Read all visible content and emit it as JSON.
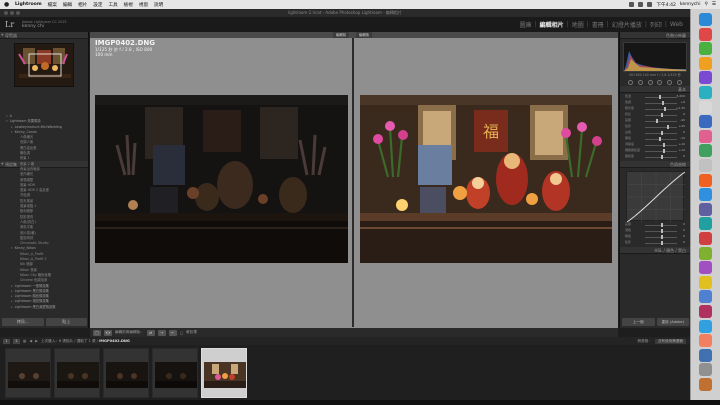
{
  "menubar": {
    "items": [
      "Lightroom",
      "檔案",
      "編輯",
      "相片",
      "設定",
      "工具",
      "檢視",
      "視窗",
      "說明"
    ],
    "clock": "下午4:42",
    "user": "kennychi"
  },
  "window_title": "lightroom-2.lrcat - Adobe Photoshop Lightroom - 編輯相片",
  "identity": {
    "line1": "Adobe Lightroom CC 2015",
    "line2": "kenny chi"
  },
  "modules": [
    {
      "label": "圖庫",
      "active": false
    },
    {
      "label": "編輯相片",
      "active": true
    },
    {
      "label": "地圖",
      "active": false
    },
    {
      "label": "書冊",
      "active": false
    },
    {
      "label": "幻燈片播放",
      "active": false
    },
    {
      "label": "列印",
      "active": false
    },
    {
      "label": "Web",
      "active": false
    }
  ],
  "left_panel": {
    "navigator_title": "導覽器",
    "presets_title": "預設集",
    "presets": [
      {
        "label": "A",
        "level": 0,
        "open": true
      },
      {
        "label": "Lightroom 效果預設",
        "level": 0,
        "open": true
      },
      {
        "label": "Lowkeyinstruct-MiniWedding",
        "level": 1
      },
      {
        "label": "Kenny_Canon",
        "level": 1,
        "open": true
      },
      {
        "label": "人像補光",
        "level": 2
      },
      {
        "label": "低調人像",
        "level": 2
      },
      {
        "label": "黑白高反差",
        "level": 2
      },
      {
        "label": "暖色調",
        "level": 2
      },
      {
        "label": "夜景 1",
        "level": 2
      },
      {
        "label": "夜景 2 暖",
        "level": 2
      },
      {
        "label": "夜景加亮暗部",
        "level": 2
      },
      {
        "label": "室內補光",
        "level": 2
      },
      {
        "label": "食物調整",
        "level": 2
      },
      {
        "label": "風景 HDR",
        "level": 2
      },
      {
        "label": "風景 HDR 2 高反差",
        "level": 2
      },
      {
        "label": "冷色調",
        "level": 2
      },
      {
        "label": "陰天風景",
        "level": 2
      },
      {
        "label": "風景增豔 1",
        "level": 2
      },
      {
        "label": "銳利細節",
        "level": 2
      },
      {
        "label": "陰影提亮",
        "level": 2
      },
      {
        "label": "人像(亮白)",
        "level": 2
      },
      {
        "label": "膚色平衡",
        "level": 2
      },
      {
        "label": "底片感(暖)",
        "level": 2
      },
      {
        "label": "藍色時刻",
        "level": 2
      },
      {
        "label": "Chromatic Studio",
        "level": 2
      },
      {
        "label": "Kenny_Nikon",
        "level": 1,
        "open": true
      },
      {
        "label": "Nikon_A_Profit",
        "level": 2
      },
      {
        "label": "Nikon_A_Profit 2",
        "level": 2
      },
      {
        "label": "Nik 暗部",
        "level": 2
      },
      {
        "label": "Nikon 夜景",
        "level": 2
      },
      {
        "label": "Nikon City 暖色後期",
        "level": 2
      },
      {
        "label": "Chrome 色調加深",
        "level": 2
      },
      {
        "label": "Lightroom 一般預設集",
        "level": 1
      },
      {
        "label": "Lightroom 黑白預設集",
        "level": 1
      },
      {
        "label": "Lightroom 顏色預設集",
        "level": 1
      },
      {
        "label": "Lightroom 視訊預設集",
        "level": 1
      },
      {
        "label": "Lightroom 黑白濾鏡預設集",
        "level": 1
      },
      {
        "label": "Lightroom 黑白調色預設集",
        "level": 1
      },
      {
        "label": "Lightroom 曲線預設集",
        "level": 1
      }
    ],
    "copy_button": "拷貝...",
    "paste_button": "貼上"
  },
  "center": {
    "before_label": "編輯前",
    "after_label": "編輯後",
    "filename": "IMGP0402.DNG",
    "exposure": "1/125 秒 於 f / 2.8 , ISO 800",
    "focal": "100 mm",
    "toolbar_label": "編輯前與編輯後：",
    "toolbar_label2": "軟校樣"
  },
  "right_panel": {
    "histogram_title": "色階分佈圖",
    "histogram_info": "ISO 800   100 mm   f / 2.8   1/125 秒",
    "basic_title": "基本",
    "basic_sliders": [
      {
        "label": "色溫",
        "pos": 0.45,
        "val": "3,200"
      },
      {
        "label": "色調",
        "pos": 0.52,
        "val": "+6"
      },
      {
        "label": "曝光度",
        "pos": 0.6,
        "val": "+1.35"
      },
      {
        "label": "對比",
        "pos": 0.5,
        "val": "0"
      },
      {
        "label": "亮部",
        "pos": 0.35,
        "val": "-40"
      },
      {
        "label": "陰影",
        "pos": 0.7,
        "val": "+45"
      },
      {
        "label": "白色",
        "pos": 0.5,
        "val": "0"
      },
      {
        "label": "黑色",
        "pos": 0.45,
        "val": "-10"
      },
      {
        "label": "清晰度",
        "pos": 0.55,
        "val": "+10"
      },
      {
        "label": "細節飽和度",
        "pos": 0.55,
        "val": "+12"
      },
      {
        "label": "飽和度",
        "pos": 0.5,
        "val": "0"
      }
    ],
    "curve_title": "色調曲線",
    "curve_sliders": [
      {
        "label": "亮部",
        "pos": 0.5,
        "val": "0"
      },
      {
        "label": "淺色",
        "pos": 0.5,
        "val": "0"
      },
      {
        "label": "暗色",
        "pos": 0.5,
        "val": "0"
      },
      {
        "label": "陰影",
        "pos": 0.5,
        "val": "0"
      }
    ],
    "hsl_title": "HSL / 顏色 / 黑白",
    "prev_button": "上一個",
    "reset_button": "重設 (Adobe)"
  },
  "filmstrip": {
    "num1": "1",
    "num2": "2",
    "path": "上次匯入：6 張相片 / 選取了 1 張 /",
    "path_file": "IMGP0402.DNG",
    "filter_label": "篩選器：",
    "filter_value": "沒有使用篩選器"
  }
}
